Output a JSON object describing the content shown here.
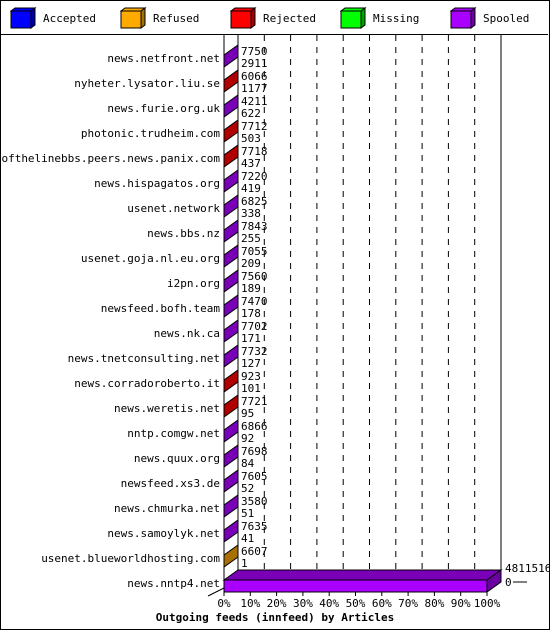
{
  "legend": [
    {
      "label": "Accepted",
      "color": "#0000ff",
      "side": "#0000a0"
    },
    {
      "label": "Refused",
      "color": "#ffaa00",
      "side": "#a07000"
    },
    {
      "label": "Rejected",
      "color": "#ff0000",
      "side": "#a00000"
    },
    {
      "label": "Missing",
      "color": "#00ff00",
      "side": "#00a000"
    },
    {
      "label": "Spooled",
      "color": "#aa00ff",
      "side": "#7000a0"
    }
  ],
  "chart_data": {
    "type": "bar",
    "orientation": "horizontal",
    "stacked": true,
    "title": "Outgoing feeds (innfeed) by Articles",
    "xlabel": "Outgoing feeds (innfeed) by Articles",
    "xlim": [
      0,
      100
    ],
    "x_unit": "%",
    "x_ticks": [
      "0%",
      "10%",
      "20%",
      "30%",
      "40%",
      "50%",
      "60%",
      "70%",
      "80%",
      "90%",
      "100%"
    ],
    "grid": true,
    "legend_position": "top",
    "series_names": [
      "Accepted",
      "Refused",
      "Rejected",
      "Missing",
      "Spooled"
    ],
    "categories": [
      {
        "name": "news.netfront.net",
        "top_value": "7750",
        "bottom_value": "2911",
        "face_color": "#7a00b8",
        "fill_pct": 0
      },
      {
        "name": "nyheter.lysator.liu.se",
        "top_value": "6066",
        "bottom_value": "1177",
        "face_color": "#b00000",
        "fill_pct": 0
      },
      {
        "name": "news.furie.org.uk",
        "top_value": "4211",
        "bottom_value": "622",
        "face_color": "#7a00b8",
        "fill_pct": 0
      },
      {
        "name": "photonic.trudheim.com",
        "top_value": "7712",
        "bottom_value": "503",
        "face_color": "#b00000",
        "fill_pct": 0
      },
      {
        "name": "endofthelinebbs.peers.news.panix.com",
        "top_value": "7718",
        "bottom_value": "437",
        "face_color": "#b00000",
        "fill_pct": 0
      },
      {
        "name": "news.hispagatos.org",
        "top_value": "7220",
        "bottom_value": "419",
        "face_color": "#7a00b8",
        "fill_pct": 0
      },
      {
        "name": "usenet.network",
        "top_value": "6825",
        "bottom_value": "338",
        "face_color": "#7a00b8",
        "fill_pct": 0
      },
      {
        "name": "news.bbs.nz",
        "top_value": "7843",
        "bottom_value": "255",
        "face_color": "#7a00b8",
        "fill_pct": 0
      },
      {
        "name": "usenet.goja.nl.eu.org",
        "top_value": "7055",
        "bottom_value": "209",
        "face_color": "#7a00b8",
        "fill_pct": 0
      },
      {
        "name": "i2pn.org",
        "top_value": "7560",
        "bottom_value": "189",
        "face_color": "#7a00b8",
        "fill_pct": 0
      },
      {
        "name": "newsfeed.bofh.team",
        "top_value": "7470",
        "bottom_value": "178",
        "face_color": "#7a00b8",
        "fill_pct": 0
      },
      {
        "name": "news.nk.ca",
        "top_value": "7702",
        "bottom_value": "171",
        "face_color": "#7a00b8",
        "fill_pct": 0
      },
      {
        "name": "news.tnetconsulting.net",
        "top_value": "7732",
        "bottom_value": "127",
        "face_color": "#7a00b8",
        "fill_pct": 0
      },
      {
        "name": "news.corradoroberto.it",
        "top_value": "923",
        "bottom_value": "101",
        "face_color": "#b00000",
        "fill_pct": 0
      },
      {
        "name": "news.weretis.net",
        "top_value": "7721",
        "bottom_value": "95",
        "face_color": "#b00000",
        "fill_pct": 0
      },
      {
        "name": "nntp.comgw.net",
        "top_value": "6866",
        "bottom_value": "92",
        "face_color": "#7a00b8",
        "fill_pct": 0
      },
      {
        "name": "news.quux.org",
        "top_value": "7698",
        "bottom_value": "84",
        "face_color": "#7a00b8",
        "fill_pct": 0
      },
      {
        "name": "newsfeed.xs3.de",
        "top_value": "7605",
        "bottom_value": "52",
        "face_color": "#7a00b8",
        "fill_pct": 0
      },
      {
        "name": "news.chmurka.net",
        "top_value": "3580",
        "bottom_value": "51",
        "face_color": "#7a00b8",
        "fill_pct": 0
      },
      {
        "name": "news.samoylyk.net",
        "top_value": "7635",
        "bottom_value": "41",
        "face_color": "#7a00b8",
        "fill_pct": 0
      },
      {
        "name": "usenet.blueworldhosting.com",
        "top_value": "6607",
        "bottom_value": "1",
        "face_color": "#a87000",
        "fill_pct": 0
      },
      {
        "name": "news.nntp4.net",
        "top_value": "4811516",
        "bottom_value": "0",
        "face_color": "#aa00ff",
        "fill_pct": 100
      }
    ]
  }
}
